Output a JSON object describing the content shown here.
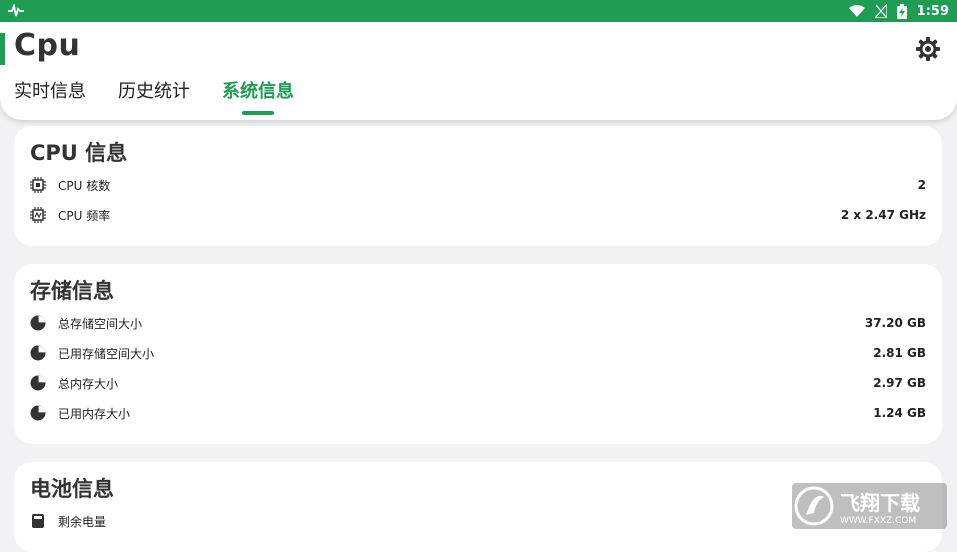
{
  "status": {
    "time": "1:59"
  },
  "app": {
    "title": "Cpu"
  },
  "tabs": [
    {
      "label": "实时信息"
    },
    {
      "label": "历史统计"
    },
    {
      "label": "系统信息"
    }
  ],
  "cpu": {
    "title": "CPU 信息",
    "rows": [
      {
        "label": "CPU 核数",
        "value": "2",
        "icon": "chip-icon"
      },
      {
        "label": "CPU 频率",
        "value": "2 x 2.47 GHz",
        "icon": "chip-frequency-icon"
      }
    ]
  },
  "storage": {
    "title": "存储信息",
    "rows": [
      {
        "label": "总存储空间大小",
        "value": "37.20 GB",
        "icon": "pie-chart-icon"
      },
      {
        "label": "已用存储空间大小",
        "value": "2.81 GB",
        "icon": "pie-chart-icon"
      },
      {
        "label": "总内存大小",
        "value": "2.97 GB",
        "icon": "pie-chart-icon"
      },
      {
        "label": "已用内存大小",
        "value": "1.24 GB",
        "icon": "pie-chart-icon"
      }
    ]
  },
  "battery": {
    "title": "电池信息",
    "rows": [
      {
        "label": "剩余电量",
        "value": "",
        "icon": "battery-icon"
      }
    ]
  },
  "watermark": {
    "text": "飞翔下载",
    "sub": "WWW.FXXZ.COM"
  },
  "colors": {
    "accent": "#1f9d55"
  }
}
